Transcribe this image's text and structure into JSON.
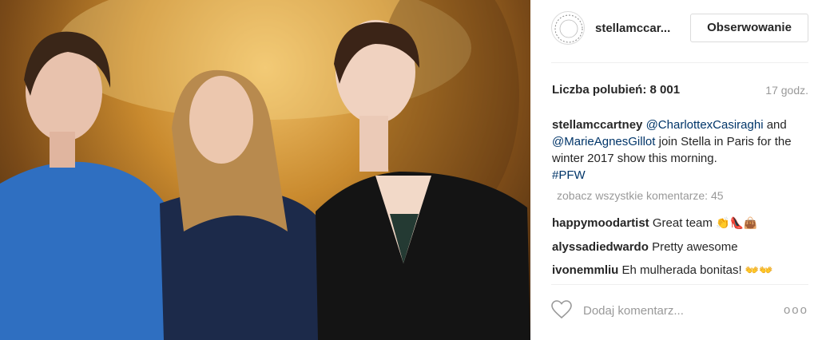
{
  "post": {
    "username": "stellamccar...",
    "follow_label": "Obserwowanie",
    "likes_text": "Liczba polubień: 8 001",
    "time_text": "17 godz.",
    "caption": {
      "author": "stellamccartney",
      "mention1": "@CharlottexCasiraghi",
      "and_text": "and",
      "mention2": "@MarieAgnesGillot",
      "text": "join Stella in Paris for the winter 2017 show this morning.",
      "hashtag": "#PFW"
    },
    "view_all": "zobacz wszystkie komentarze: 45",
    "comments": [
      {
        "user": "happymoodartist",
        "text": "Great team",
        "emoji": "👏👠👜"
      },
      {
        "user": "alyssadiedwardo",
        "text": "Pretty awesome",
        "emoji": ""
      },
      {
        "user": "ivonemmliu",
        "text": "Eh mulherada bonitas!",
        "emoji": "👐👐"
      },
      {
        "user": "",
        "text": "",
        "emoji": "👐"
      }
    ],
    "add_comment_placeholder": "Dodaj komentarz...",
    "more_label": "ooo"
  },
  "colors": {
    "link": "#003569",
    "muted": "#999999",
    "border": "#dbdbdb"
  }
}
